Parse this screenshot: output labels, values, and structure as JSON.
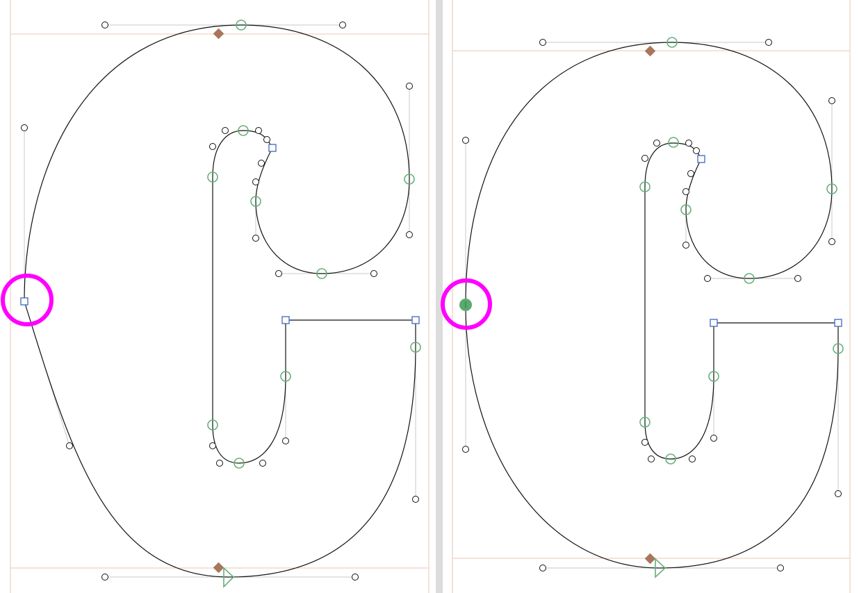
{
  "editor": {
    "left_panel": {
      "state": "before",
      "selected_node": "corner"
    },
    "right_panel": {
      "state": "after",
      "selected_node": "smooth"
    },
    "colors": {
      "outline": "#111111",
      "smooth_node": "#66b07a",
      "corner_node": "#4a72c4",
      "anchor": "#a8765a",
      "highlight": "#ff00ff",
      "metric_line": "#e7c7b5"
    },
    "icons": [
      "smooth-node-icon",
      "corner-node-icon",
      "off-curve-handle-icon",
      "anchor-diamond-icon",
      "start-point-triangle-icon"
    ]
  }
}
